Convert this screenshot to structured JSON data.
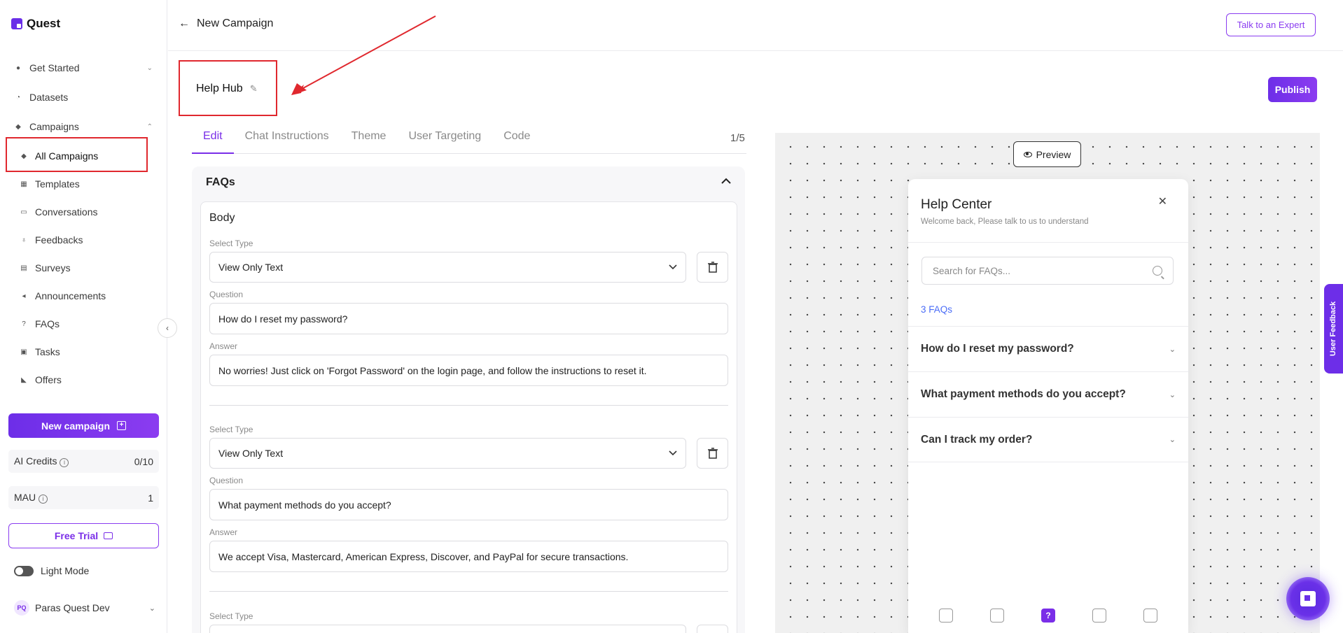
{
  "app": {
    "name": "Quest"
  },
  "sidebar": {
    "items": [
      {
        "label": "Get Started",
        "icon": "circle-icon"
      },
      {
        "label": "Datasets",
        "icon": "dataset-icon"
      },
      {
        "label": "Campaigns",
        "icon": "layers-icon"
      },
      {
        "label": "All Campaigns",
        "icon": "layers-icon"
      },
      {
        "label": "Templates",
        "icon": "grid-icon"
      },
      {
        "label": "Conversations",
        "icon": "chat-icon"
      },
      {
        "label": "Feedbacks",
        "icon": "badge-icon"
      },
      {
        "label": "Surveys",
        "icon": "chart-icon"
      },
      {
        "label": "Announcements",
        "icon": "megaphone-icon"
      },
      {
        "label": "FAQs",
        "icon": "question-icon"
      },
      {
        "label": "Tasks",
        "icon": "clipboard-icon"
      },
      {
        "label": "Offers",
        "icon": "tag-icon"
      }
    ],
    "new_campaign_label": "New campaign",
    "ai_credits": {
      "label": "AI Credits",
      "value": "0/10"
    },
    "mau": {
      "label": "MAU",
      "value": "1"
    },
    "free_trial_label": "Free Trial",
    "light_mode_label": "Light Mode",
    "user": {
      "initials": "PQ",
      "name": "Paras Quest Dev"
    }
  },
  "topbar": {
    "back_label": "New Campaign",
    "expert_label": "Talk to an Expert"
  },
  "campaign": {
    "title": "Help Hub",
    "publish_label": "Publish"
  },
  "tabs": [
    "Edit",
    "Chat Instructions",
    "Theme",
    "User Targeting",
    "Code"
  ],
  "step_count": "1/5",
  "editor": {
    "section_title": "FAQs",
    "body_title": "Body",
    "select_type_label": "Select Type",
    "question_label": "Question",
    "answer_label": "Answer",
    "items": [
      {
        "type": "View Only Text",
        "question": "How do I reset my password?",
        "answer": "No worries! Just click on 'Forgot Password' on the login page, and follow the instructions to reset it."
      },
      {
        "type": "View Only Text",
        "question": "What payment methods do you accept?",
        "answer": "We accept Visa, Mastercard, American Express, Discover, and PayPal for secure transactions."
      }
    ]
  },
  "preview": {
    "button_label": "Preview",
    "widget": {
      "title": "Help Center",
      "subtitle": "Welcome back, Please talk to us to understand",
      "search_placeholder": "Search for FAQs...",
      "count_label": "3 FAQs",
      "faqs": [
        "How do I reset my password?",
        "What payment methods do you accept?",
        "Can I track my order?"
      ]
    }
  },
  "feedback_tab_label": "User Feedback",
  "colors": {
    "accent": "#7a2ee8",
    "highlight": "#e0282e",
    "link": "#4a6cf7"
  }
}
